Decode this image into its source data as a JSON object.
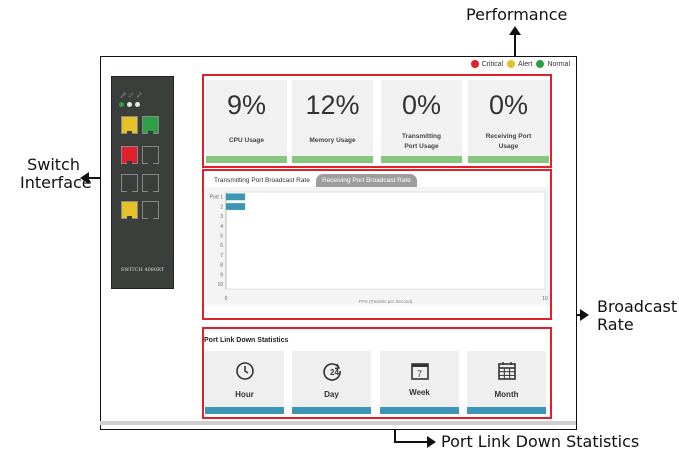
{
  "callouts": {
    "performance": "Performance",
    "switch_interface_1": "Switch",
    "switch_interface_2": "Interface",
    "broadcast_1": "Broadcast",
    "broadcast_2": "Rate",
    "port_link_down": "Port Link Down Statistics"
  },
  "device": {
    "label": "SWITCH 4080RT",
    "led_labels": [
      "PWR",
      "SYS",
      "ALM"
    ],
    "port_colors": [
      "#e7c12a",
      "#2ea043",
      "#e0202a",
      "#3a3f3b",
      "#3a3f3b",
      "#3a3f3b",
      "#e7c12a",
      "#3a3f3b"
    ]
  },
  "legend": {
    "critical": "Critical",
    "alert": "Alert",
    "normal": "Normal",
    "colors": {
      "critical": "#e0202a",
      "alert": "#e7c12a",
      "normal": "#2ea043"
    }
  },
  "performance": {
    "cards": [
      {
        "value": "9%",
        "label": "CPU Usage"
      },
      {
        "value": "12%",
        "label": "Memory Usage"
      },
      {
        "value": "0%",
        "label": "Transmitting Port Usage"
      },
      {
        "value": "0%",
        "label": "Receiving Port Usage"
      }
    ]
  },
  "broadcast": {
    "tab_tx": "Transmitting Port Broadcast Rate",
    "tab_rx": "Receiving Port Broadcast Rate"
  },
  "chart_data": {
    "type": "bar",
    "orientation": "horizontal",
    "categories": [
      "Port 1",
      "2",
      "3",
      "4",
      "5",
      "6",
      "7",
      "8",
      "9",
      "10"
    ],
    "values": [
      3,
      3,
      0,
      0,
      0,
      0,
      0,
      0,
      0,
      0
    ],
    "xlim": [
      0,
      50
    ],
    "xticks": [
      "0",
      "10"
    ],
    "xlabel": "PPS (Packets per Second)",
    "ylabel": "",
    "bar_color": "#3d96b8"
  },
  "link_down": {
    "title": "Port Link Down Statistics",
    "cards": [
      {
        "label": "Hour",
        "icon": "clock-icon"
      },
      {
        "label": "Day",
        "icon": "day-24h-icon"
      },
      {
        "label": "Week",
        "icon": "calendar-week-icon",
        "icon_text": "7"
      },
      {
        "label": "Month",
        "icon": "calendar-month-icon"
      }
    ]
  }
}
